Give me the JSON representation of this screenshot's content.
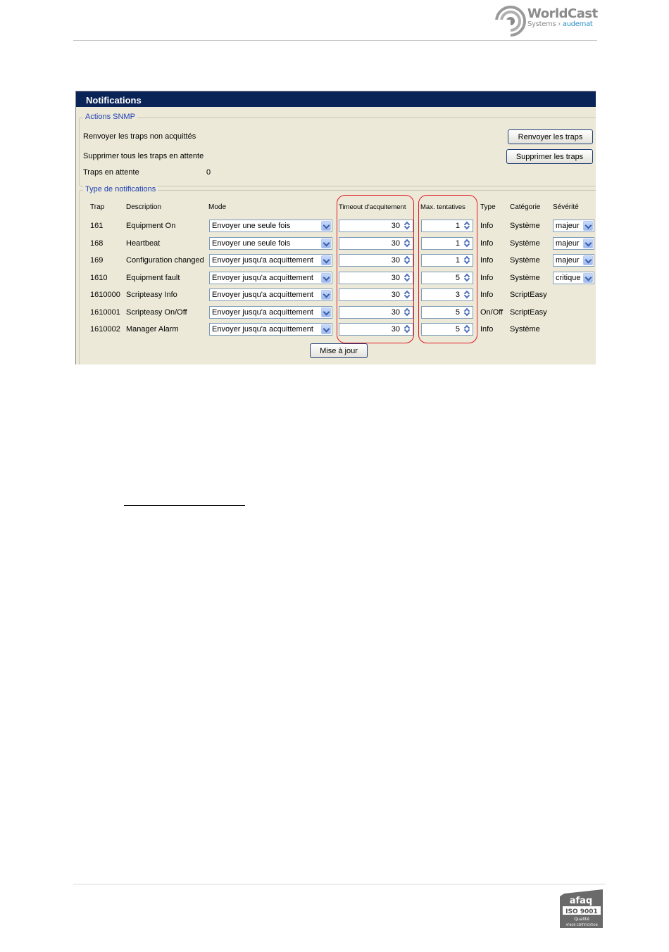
{
  "page": {
    "logo_word": "WorldCast",
    "logo_sub_a": "Systems",
    "logo_sub_sep": "›",
    "logo_sub_b": "audemat",
    "cert_logo": "afaq-iso-9001-logo",
    "cert_text": [
      "afaq",
      "ISO 9001",
      "Qualité",
      "AFNOR CERTIFICATION"
    ]
  },
  "panel": {
    "title": "Notifications",
    "snmp_group_legend": "Actions SNMP",
    "resend_label": "Renvoyer les traps non acquittés",
    "resend_button": "Renvoyer les traps",
    "delete_label": "Supprimer tous les traps en attente",
    "delete_button": "Supprimer les traps",
    "pending_label": "Traps en attente",
    "pending_value": "0",
    "notif_group_legend": "Type de notifications",
    "update_button": "Mise à jour"
  },
  "table": {
    "headers": [
      "Trap",
      "Description",
      "Mode",
      "Timeout d'acquitement",
      "Max. tentatives",
      "Type",
      "Catégorie",
      "Sévérité"
    ],
    "rows": [
      {
        "trap": "161",
        "description": "Equipment On",
        "mode": "Envoyer une seule fois",
        "timeout": "30",
        "max": "1",
        "type": "Info",
        "category": "Système",
        "severity": "majeur"
      },
      {
        "trap": "168",
        "description": "Heartbeat",
        "mode": "Envoyer une seule fois",
        "timeout": "30",
        "max": "1",
        "type": "Info",
        "category": "Système",
        "severity": "majeur"
      },
      {
        "trap": "169",
        "description": "Configuration changed",
        "mode": "Envoyer jusqu'a acquittement",
        "timeout": "30",
        "max": "1",
        "type": "Info",
        "category": "Système",
        "severity": "majeur"
      },
      {
        "trap": "1610",
        "description": "Equipment fault",
        "mode": "Envoyer jusqu'a acquittement",
        "timeout": "30",
        "max": "5",
        "type": "Info",
        "category": "Système",
        "severity": "critique"
      },
      {
        "trap": "1610000",
        "description": "Scripteasy Info",
        "mode": "Envoyer jusqu'a acquittement",
        "timeout": "30",
        "max": "3",
        "type": "Info",
        "category": "ScriptEasy",
        "severity": null
      },
      {
        "trap": "1610001",
        "description": "Scripteasy On/Off",
        "mode": "Envoyer jusqu'a acquittement",
        "timeout": "30",
        "max": "5",
        "type": "On/Off",
        "category": "ScriptEasy",
        "severity": null
      },
      {
        "trap": "1610002",
        "description": "Manager Alarm",
        "mode": "Envoyer jusqu'a acquittement",
        "timeout": "30",
        "max": "5",
        "type": "Info",
        "category": "Système",
        "severity": null
      }
    ]
  },
  "colors": {
    "title_bar": "#0a2458",
    "panel_bg": "#ece9d8",
    "legend_text": "#1e3fb4",
    "highlight": "#e0191f"
  }
}
